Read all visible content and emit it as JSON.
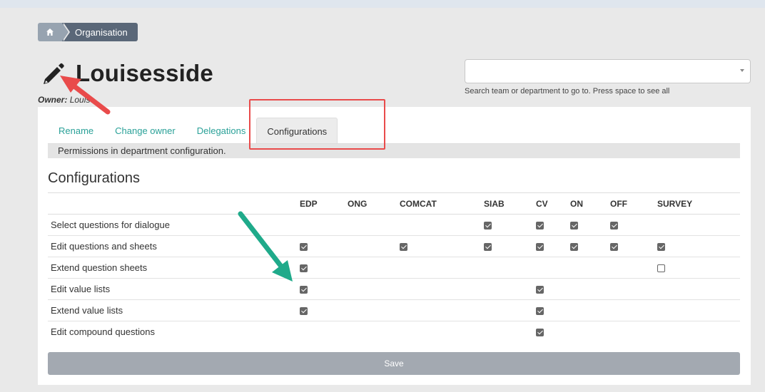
{
  "breadcrumb": {
    "home_icon": "home-icon",
    "current": "Organisation"
  },
  "page": {
    "icon": "pencil-icon",
    "title": "Louisesside",
    "owner_label": "Owner:",
    "owner_value": "Louise"
  },
  "search": {
    "value": "",
    "hint": "Search team or department to go to. Press space to see all"
  },
  "tabs": [
    {
      "label": "Rename",
      "active": false
    },
    {
      "label": "Change owner",
      "active": false
    },
    {
      "label": "Delegations",
      "active": false
    },
    {
      "label": "Configurations",
      "active": true
    }
  ],
  "info_text": "Permissions in department configuration.",
  "section_title": "Configurations",
  "table": {
    "columns": [
      "EDP",
      "ONG",
      "COMCAT",
      "SIAB",
      "CV",
      "ON",
      "OFF",
      "SURVEY"
    ],
    "rows": [
      {
        "label": "Select questions for dialogue",
        "cells": [
          null,
          null,
          null,
          true,
          true,
          true,
          true,
          null
        ]
      },
      {
        "label": "Edit questions and sheets",
        "cells": [
          true,
          null,
          true,
          true,
          true,
          true,
          true,
          true
        ]
      },
      {
        "label": "Extend question sheets",
        "cells": [
          true,
          null,
          null,
          null,
          null,
          null,
          null,
          false
        ]
      },
      {
        "label": "Edit value lists",
        "cells": [
          true,
          null,
          null,
          null,
          true,
          null,
          null,
          null
        ]
      },
      {
        "label": "Extend value lists",
        "cells": [
          true,
          null,
          null,
          null,
          true,
          null,
          null,
          null
        ]
      },
      {
        "label": "Edit compound questions",
        "cells": [
          null,
          null,
          null,
          null,
          true,
          null,
          null,
          null
        ]
      }
    ]
  },
  "save_label": "Save",
  "colors": {
    "link": "#2aa198",
    "annotation_red": "#e94b4b",
    "annotation_green": "#1faa8a",
    "breadcrumb_dark": "#5a6778"
  }
}
